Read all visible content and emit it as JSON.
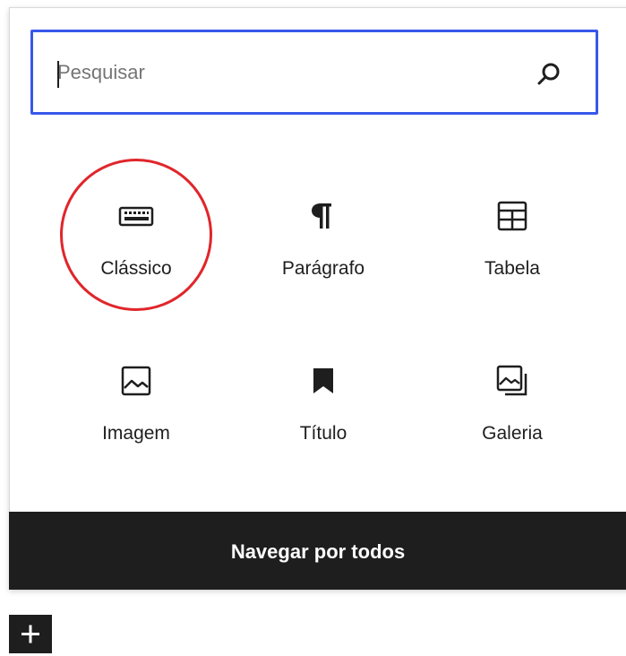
{
  "search": {
    "placeholder": "Pesquisar",
    "value": "",
    "icon": "search-icon"
  },
  "blocks": [
    {
      "label": "Clássico",
      "icon": "keyboard-icon",
      "highlighted": true
    },
    {
      "label": "Parágrafo",
      "icon": "paragraph-icon",
      "highlighted": false
    },
    {
      "label": "Tabela",
      "icon": "table-icon",
      "highlighted": false
    },
    {
      "label": "Imagem",
      "icon": "image-icon",
      "highlighted": false
    },
    {
      "label": "Título",
      "icon": "bookmark-icon",
      "highlighted": false
    },
    {
      "label": "Galeria",
      "icon": "gallery-icon",
      "highlighted": false
    }
  ],
  "browse_all": {
    "label": "Navegar por todos"
  },
  "inserter_toggle": {
    "icon": "plus-icon"
  },
  "colors": {
    "accent": "#3858e9",
    "highlight_ring": "#e0262b",
    "dark": "#1e1e1e"
  }
}
